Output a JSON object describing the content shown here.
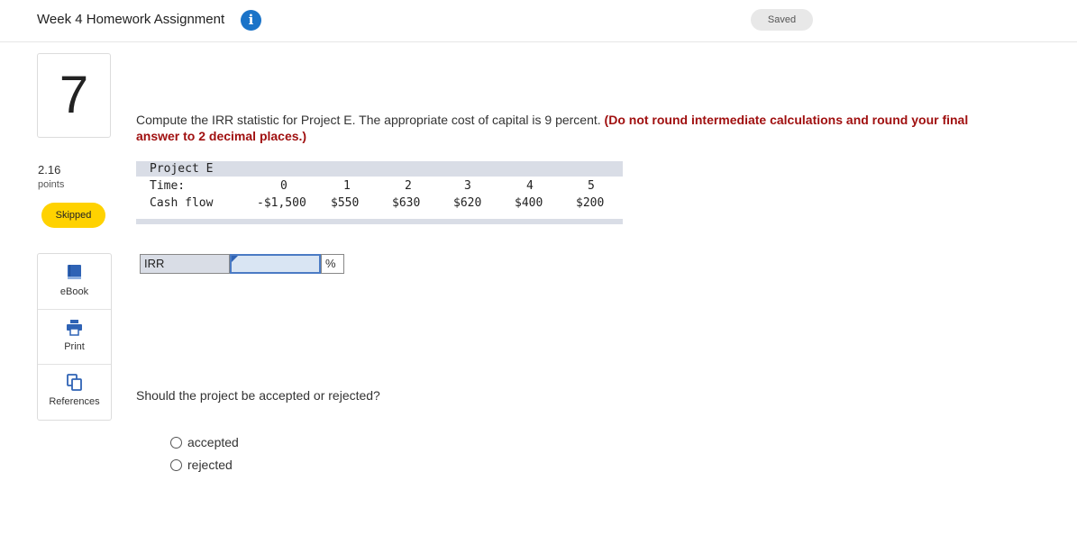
{
  "header": {
    "title": "Week 4 Homework Assignment",
    "info_icon": "info-icon",
    "status": "Saved"
  },
  "question_panel": {
    "number": "7",
    "points_value": "2.16",
    "points_label": "points",
    "status_badge": "Skipped"
  },
  "tools": [
    {
      "icon": "book-icon",
      "label": "eBook"
    },
    {
      "icon": "printer-icon",
      "label": "Print"
    },
    {
      "icon": "copy-pages-icon",
      "label": "References"
    }
  ],
  "question": {
    "text": "Compute the IRR statistic for Project E. The appropriate cost of capital is 9 percent. ",
    "note": "(Do not round intermediate calculations and round your final answer to 2 decimal places.)"
  },
  "project_table": {
    "title": "Project E",
    "time_label": "Time:",
    "cashflow_label": "Cash flow",
    "times": [
      "0",
      "1",
      "2",
      "3",
      "4",
      "5"
    ],
    "cash_flows": [
      "-$1,500",
      "$550",
      "$630",
      "$620",
      "$400",
      "$200"
    ]
  },
  "answer": {
    "label": "IRR",
    "value": "",
    "unit": "%"
  },
  "decision": {
    "question": "Should the project be accepted or rejected?",
    "options": [
      "accepted",
      "rejected"
    ]
  },
  "colors": {
    "accent_blue": "#1a73c8",
    "badge_yellow": "#ffd200",
    "note_red": "#a01010",
    "table_band": "#d9dde6"
  }
}
